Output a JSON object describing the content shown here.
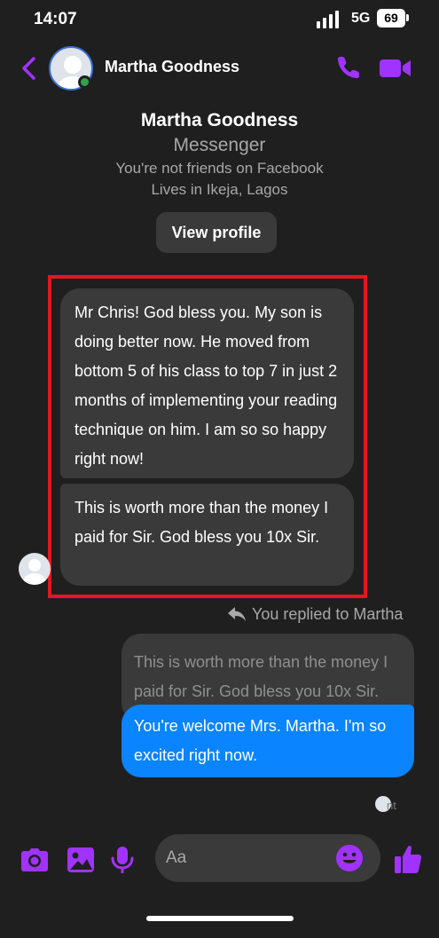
{
  "status": {
    "time": "14:07",
    "network": "5G",
    "battery": "69"
  },
  "header": {
    "name": "Martha Goodness",
    "online": true
  },
  "profile": {
    "name": "Martha Goodness",
    "app": "Messenger",
    "friends_note": "You're not friends on Facebook",
    "location": "Lives in Ikeja, Lagos",
    "view_profile_label": "View profile"
  },
  "messages": {
    "incoming": [
      "Mr Chris! God bless you. My son is doing better now. He moved from bottom 5 of his class to top 7 in just 2 months of implementing your reading technique on him. I am so so happy right now!",
      "This is worth more than the money I paid for Sir. God bless you 10x Sir."
    ],
    "reply_note": "You replied to Martha",
    "quoted": "This is worth more than the money I paid for Sir. God bless you 10x Sir.",
    "outgoing": "You're welcome Mrs. Martha. I'm so excited right now.",
    "seen_text": "nt"
  },
  "composer": {
    "placeholder": "Aa"
  },
  "colors": {
    "accent": "#a033ff",
    "outgoing_bubble": "#0a84ff",
    "highlight": "#e3171d"
  }
}
